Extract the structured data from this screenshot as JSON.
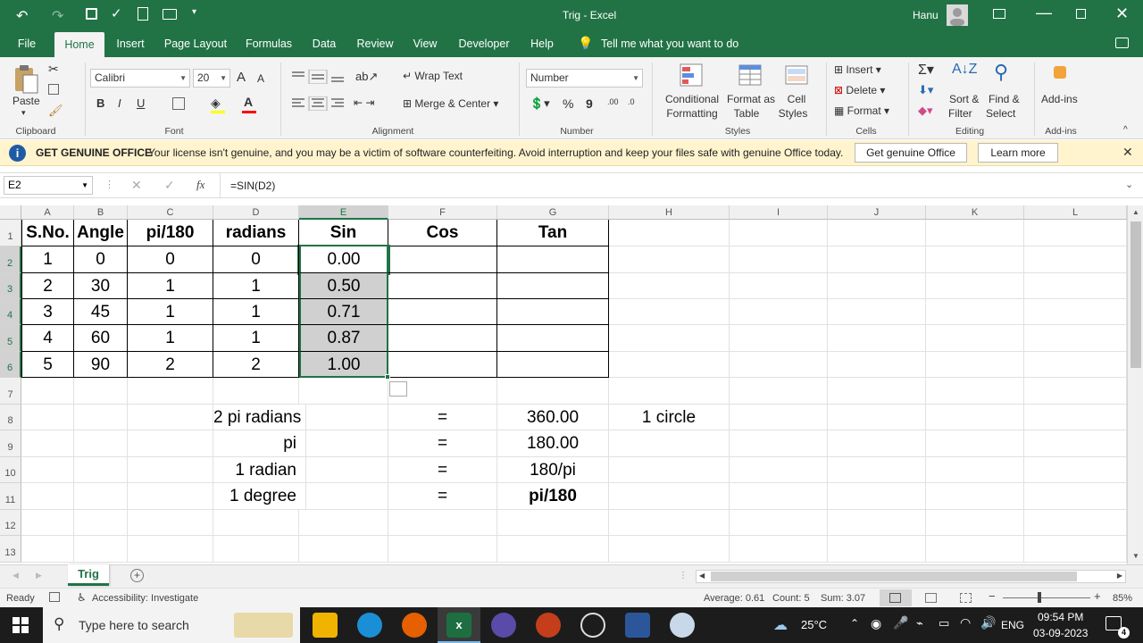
{
  "titlebar": {
    "title": "Trig  -  Excel",
    "user": "Hanu"
  },
  "tabs": [
    "File",
    "Home",
    "Insert",
    "Page Layout",
    "Formulas",
    "Data",
    "Review",
    "View",
    "Developer",
    "Help"
  ],
  "tell_me": "Tell me what you want to do",
  "ribbon": {
    "clipboard": {
      "paste": "Paste",
      "label": "Clipboard"
    },
    "font": {
      "name": "Calibri",
      "size": "20",
      "label": "Font",
      "bold": "B",
      "italic": "I",
      "underline": "U",
      "grow": "A",
      "shrink": "A"
    },
    "alignment": {
      "wrap": "Wrap Text",
      "merge": "Merge & Center",
      "label": "Alignment"
    },
    "number": {
      "format": "Number",
      "label": "Number",
      "percent": "%",
      "comma": "9"
    },
    "styles": {
      "conditional1": "Conditional",
      "conditional2": "Formatting",
      "format_table1": "Format as",
      "format_table2": "Table",
      "cell_styles1": "Cell",
      "cell_styles2": "Styles",
      "label": "Styles"
    },
    "cells": {
      "insert": "Insert",
      "delete": "Delete",
      "format": "Format",
      "label": "Cells"
    },
    "editing": {
      "sort1": "Sort &",
      "sort2": "Filter",
      "find1": "Find &",
      "find2": "Select",
      "label": "Editing"
    },
    "addins": {
      "addins": "Add-ins",
      "label": "Add-ins"
    }
  },
  "banner": {
    "title": "GET GENUINE OFFICE",
    "message": "Your license isn't genuine, and you may be a victim of software counterfeiting. Avoid interruption and keep your files safe with genuine Office today.",
    "btn_genuine": "Get genuine Office",
    "btn_learn": "Learn more"
  },
  "formula_bar": {
    "name_box": "E2",
    "formula": "=SIN(D2)",
    "fx": "fx"
  },
  "columns": [
    "A",
    "B",
    "C",
    "D",
    "E",
    "F",
    "G",
    "H",
    "I",
    "J",
    "K",
    "L"
  ],
  "rows": [
    "1",
    "2",
    "3",
    "4",
    "5",
    "6",
    "7",
    "8",
    "9",
    "10",
    "11",
    "12",
    "13"
  ],
  "table": {
    "headers": [
      "S.No.",
      "Angle",
      "pi/180",
      "radians",
      "Sin",
      "Cos",
      "Tan"
    ],
    "data": [
      [
        "1",
        "0",
        "0",
        "0",
        "0.00",
        "",
        ""
      ],
      [
        "2",
        "30",
        "1",
        "1",
        "0.50",
        "",
        ""
      ],
      [
        "3",
        "45",
        "1",
        "1",
        "0.71",
        "",
        ""
      ],
      [
        "4",
        "60",
        "1",
        "1",
        "0.87",
        "",
        ""
      ],
      [
        "5",
        "90",
        "2",
        "2",
        "1.00",
        "",
        ""
      ]
    ]
  },
  "notes": [
    {
      "left": "2 pi radians",
      "eq": "=",
      "right": "360.00",
      "extra": "1 circle"
    },
    {
      "left": "pi",
      "eq": "=",
      "right": "180.00",
      "extra": ""
    },
    {
      "left": "1 radian",
      "eq": "=",
      "right": "180/pi",
      "extra": ""
    },
    {
      "left": "1 degree",
      "eq": "=",
      "right": "pi/180",
      "extra": ""
    }
  ],
  "sheet_tab": "Trig",
  "status": {
    "ready": "Ready",
    "accessibility": "Accessibility: Investigate",
    "average": "Average: 0.61",
    "count": "Count: 5",
    "sum": "Sum: 3.07",
    "zoom": "85%"
  },
  "taskbar": {
    "search": "Type here to search",
    "weather": "25°C",
    "lang": "ENG",
    "time": "09:54 PM",
    "date": "03-09-2023",
    "notifications": "4"
  },
  "colors": {
    "excel_green": "#217346",
    "banner_bg": "#fff4ce",
    "selection_gray": "#d0d0d0"
  }
}
